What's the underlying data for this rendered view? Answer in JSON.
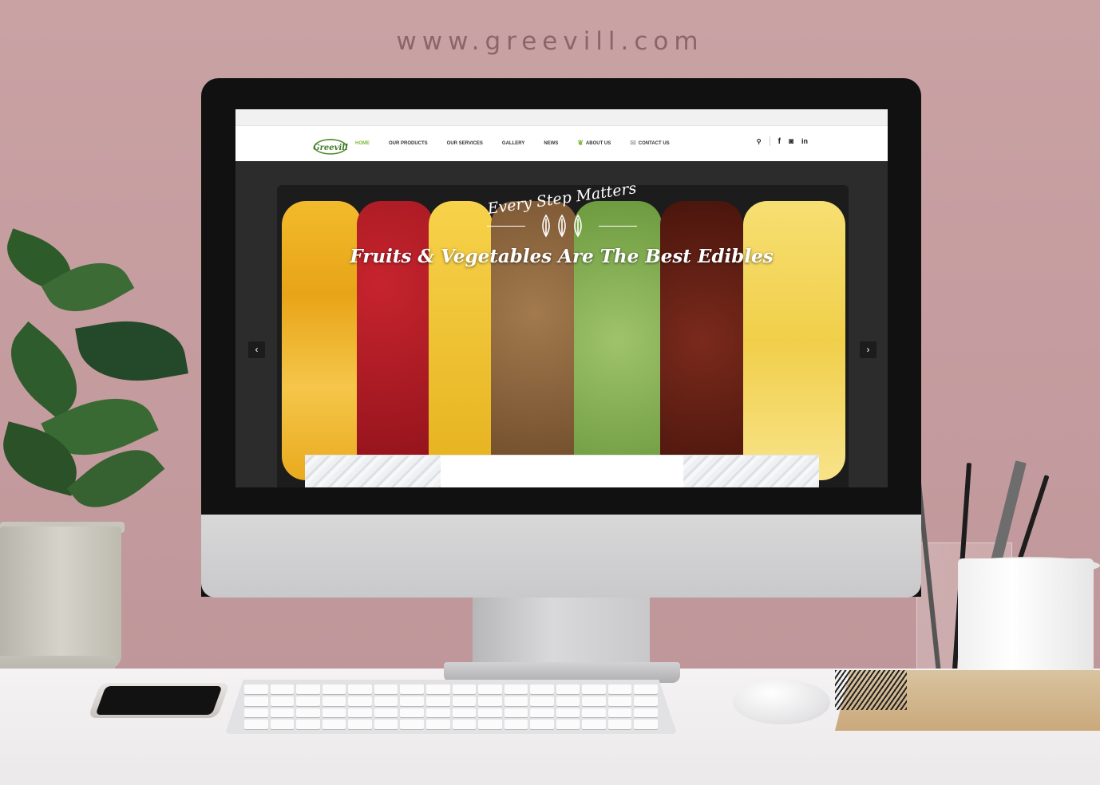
{
  "backdrop": {
    "site_url": "www.greevill.com"
  },
  "website": {
    "logo_text": "Greevill",
    "nav": {
      "items": [
        {
          "label": "HOME",
          "active": true
        },
        {
          "label": "OUR PRODUCTS",
          "active": false
        },
        {
          "label": "OUR SERVICES",
          "active": false
        },
        {
          "label": "GALLERY",
          "active": false
        },
        {
          "label": "NEWS",
          "active": false
        },
        {
          "label": "ABOUT US",
          "active": false,
          "icon": "leaf-icon"
        },
        {
          "label": "CONTACT US",
          "active": false,
          "icon": "envelope-icon"
        }
      ],
      "right_icons": [
        "search-icon",
        "facebook-icon",
        "instagram-icon",
        "linkedin-icon"
      ]
    },
    "hero": {
      "tagline": "Every Step Matters",
      "headline": "Fruits & Vegetables Are The Best Edibles",
      "prev_icon": "chevron-left-icon",
      "next_icon": "chevron-right-icon"
    },
    "colors": {
      "accent": "#7dba3b",
      "nav_text": "#333333",
      "hero_bg": "#2c2c2c"
    }
  }
}
